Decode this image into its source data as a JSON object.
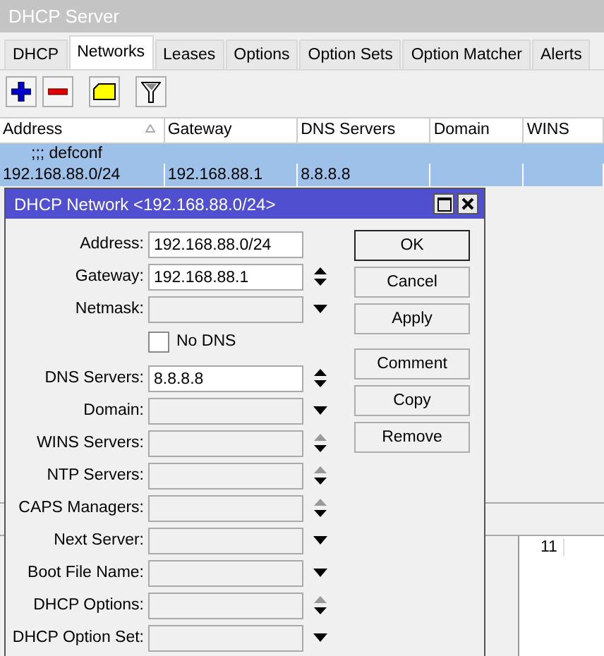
{
  "window": {
    "title": "DHCP Server"
  },
  "tabs": [
    {
      "label": "DHCP",
      "selected": false
    },
    {
      "label": "Networks",
      "selected": true
    },
    {
      "label": "Leases",
      "selected": false
    },
    {
      "label": "Options",
      "selected": false
    },
    {
      "label": "Option Sets",
      "selected": false
    },
    {
      "label": "Option Matcher",
      "selected": false
    },
    {
      "label": "Alerts",
      "selected": false
    }
  ],
  "toolbar": [
    {
      "kind": "add"
    },
    {
      "kind": "remove"
    },
    {
      "kind": "comment"
    },
    {
      "kind": "filter"
    }
  ],
  "table": {
    "columns": [
      {
        "label": "Address",
        "sorted": true
      },
      {
        "label": "Gateway",
        "sorted": false
      },
      {
        "label": "DNS Servers",
        "sorted": false
      },
      {
        "label": "Domain",
        "sorted": false
      },
      {
        "label": "WINS",
        "sorted": false
      }
    ],
    "rows": [
      {
        "kind": "comment",
        "text": ";;; defconf",
        "selected": true
      },
      {
        "kind": "data",
        "cells": [
          "192.168.88.0/24",
          "192.168.88.1",
          "8.8.8.8",
          "",
          ""
        ],
        "selected": true
      }
    ]
  },
  "background_cell": "11",
  "dialog": {
    "title": "DHCP Network <192.168.88.0/24>",
    "fields": [
      {
        "kind": "plain",
        "label": "Address:",
        "value": "192.168.88.0/24"
      },
      {
        "kind": "spin",
        "label": "Gateway:",
        "value": "192.168.88.1",
        "up_enabled": true
      },
      {
        "kind": "dropdown",
        "label": "Netmask:"
      },
      {
        "kind": "checkbox",
        "label": "No DNS",
        "checked": false
      },
      {
        "kind": "spin",
        "label": "DNS Servers:",
        "value": "8.8.8.8",
        "up_enabled": true
      },
      {
        "kind": "dropdown",
        "label": "Domain:"
      },
      {
        "kind": "spin",
        "label": "WINS Servers:",
        "up_enabled": false
      },
      {
        "kind": "spin",
        "label": "NTP Servers:",
        "up_enabled": false
      },
      {
        "kind": "spin",
        "label": "CAPS Managers:",
        "up_enabled": false
      },
      {
        "kind": "dropdown",
        "label": "Next Server:"
      },
      {
        "kind": "dropdown",
        "label": "Boot File Name:"
      },
      {
        "kind": "spin",
        "label": "DHCP Options:",
        "up_enabled": false
      },
      {
        "kind": "dropdown",
        "label": "DHCP Option Set:"
      }
    ],
    "button_groups": [
      [
        {
          "label": "OK",
          "default": true
        },
        {
          "label": "Cancel",
          "default": false
        },
        {
          "label": "Apply",
          "default": false
        }
      ],
      [
        {
          "label": "Comment",
          "default": false
        },
        {
          "label": "Copy",
          "default": false
        },
        {
          "label": "Remove",
          "default": false
        }
      ]
    ]
  }
}
